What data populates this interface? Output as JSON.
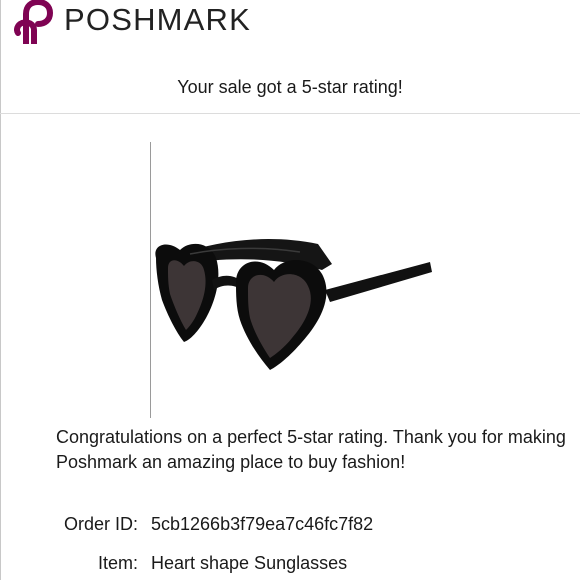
{
  "brand": {
    "name": "POSHMARK",
    "accent_color": "#7f0353",
    "logo_icon": "poshmark-p-icon"
  },
  "email": {
    "headline": "Your sale got a 5-star rating!",
    "message": "Congratulations on a perfect 5-star rating. Thank you for making Poshmark an amazing place to buy fashion!",
    "order": {
      "label": "Order ID:",
      "value": "5cb1266b3f79ea7c46fc7f82"
    },
    "item": {
      "label": "Item:",
      "value": "Heart shape Sunglasses"
    },
    "product_image_icon": "heart-sunglasses-image"
  }
}
